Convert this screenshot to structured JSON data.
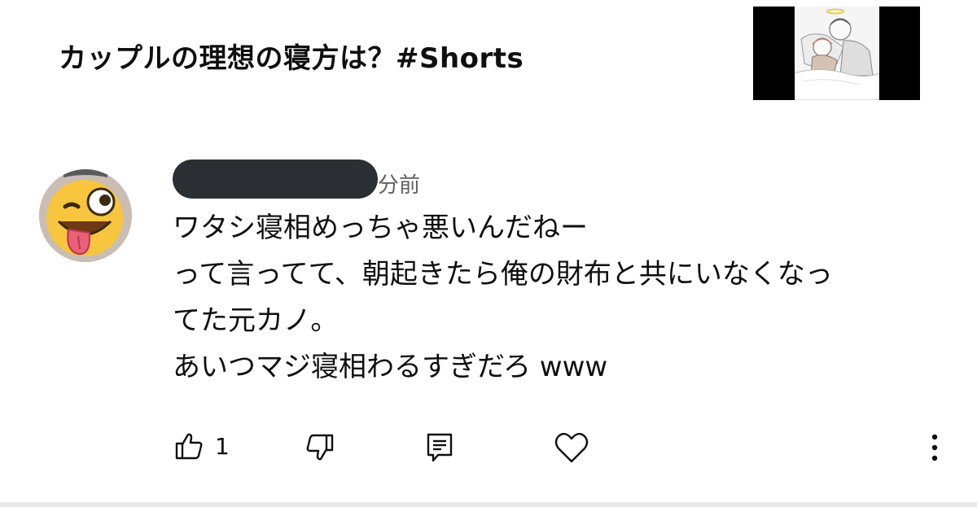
{
  "video": {
    "title": "カップルの理想の寝方は？#Shorts",
    "thumbnail_icon": "video-thumbnail"
  },
  "comment": {
    "time": "分前",
    "lines": [
      "ワタシ寝相めっちゃ悪いんだねー",
      "って言ってて、朝起きたら俺の財布と共にいなくなっ",
      "てた元カノ。",
      "あいつマジ寝相わるすぎだろ www"
    ],
    "like_count": "1"
  },
  "actions": {
    "like_icon": "thumbs-up-icon",
    "dislike_icon": "thumbs-down-icon",
    "reply_icon": "reply-comment-icon",
    "heart_icon": "heart-icon",
    "more_icon": "more-vertical-icon"
  }
}
